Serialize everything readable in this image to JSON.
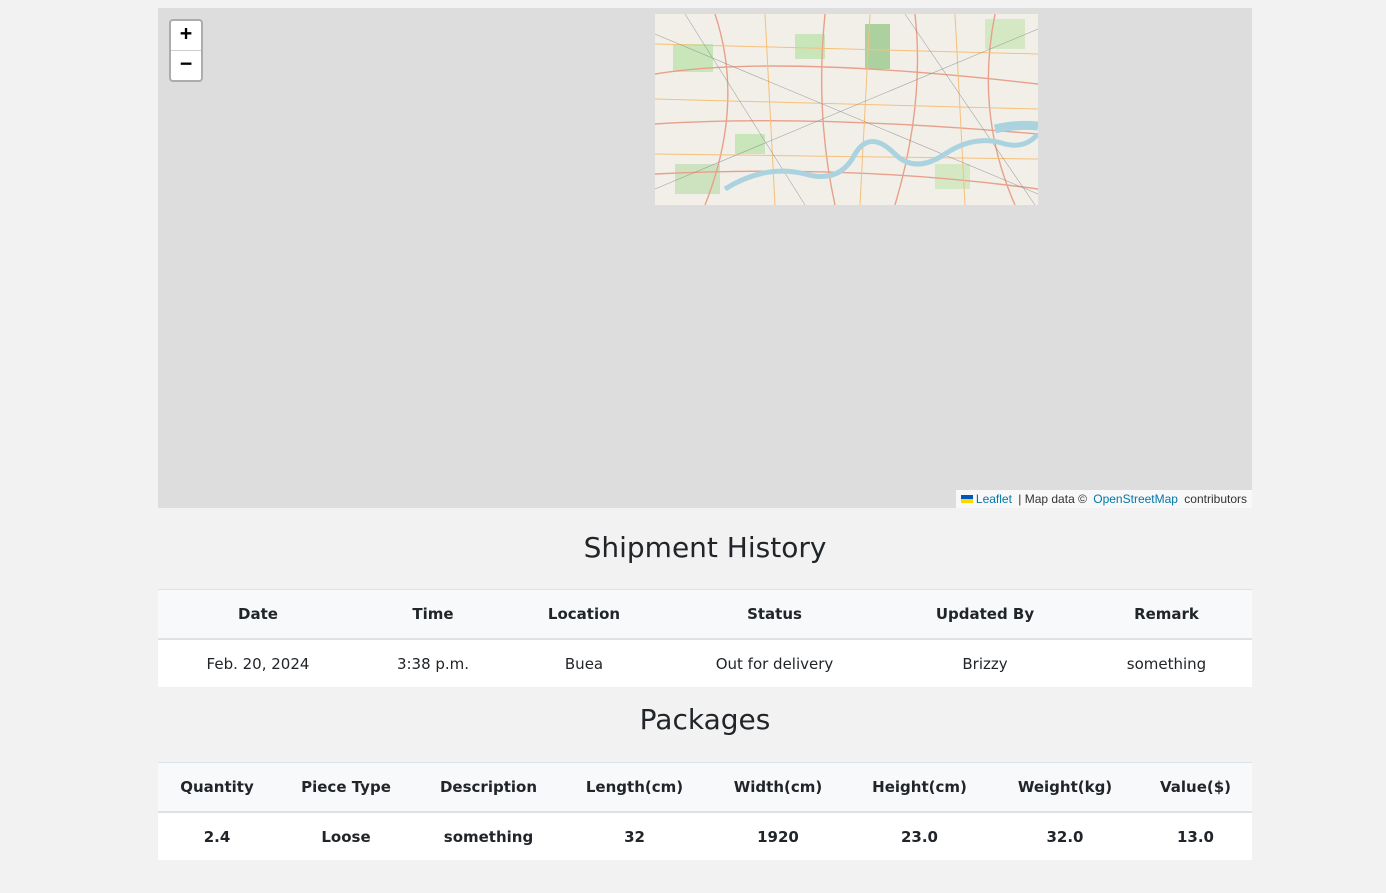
{
  "map": {
    "zoom_in_label": "+",
    "zoom_out_label": "−",
    "attribution": {
      "leaflet_link": "Leaflet",
      "separator": " | Map data © ",
      "osm_link": "OpenStreetMap",
      "suffix": " contributors"
    },
    "colors": {
      "background": "#dddddd",
      "link": "#0078a8",
      "river": "#aad3df"
    }
  },
  "history": {
    "title": "Shipment History",
    "columns": [
      "Date",
      "Time",
      "Location",
      "Status",
      "Updated By",
      "Remark"
    ],
    "rows": [
      [
        "Feb. 20, 2024",
        "3:38 p.m.",
        "Buea",
        "Out for delivery",
        "Brizzy",
        "something"
      ]
    ]
  },
  "packages": {
    "title": "Packages",
    "columns": [
      "Quantity",
      "Piece Type",
      "Description",
      "Length(cm)",
      "Width(cm)",
      "Height(cm)",
      "Weight(kg)",
      "Value($)"
    ],
    "rows": [
      [
        "2.4",
        "Loose",
        "something",
        "32",
        "1920",
        "23.0",
        "32.0",
        "13.0"
      ]
    ]
  }
}
